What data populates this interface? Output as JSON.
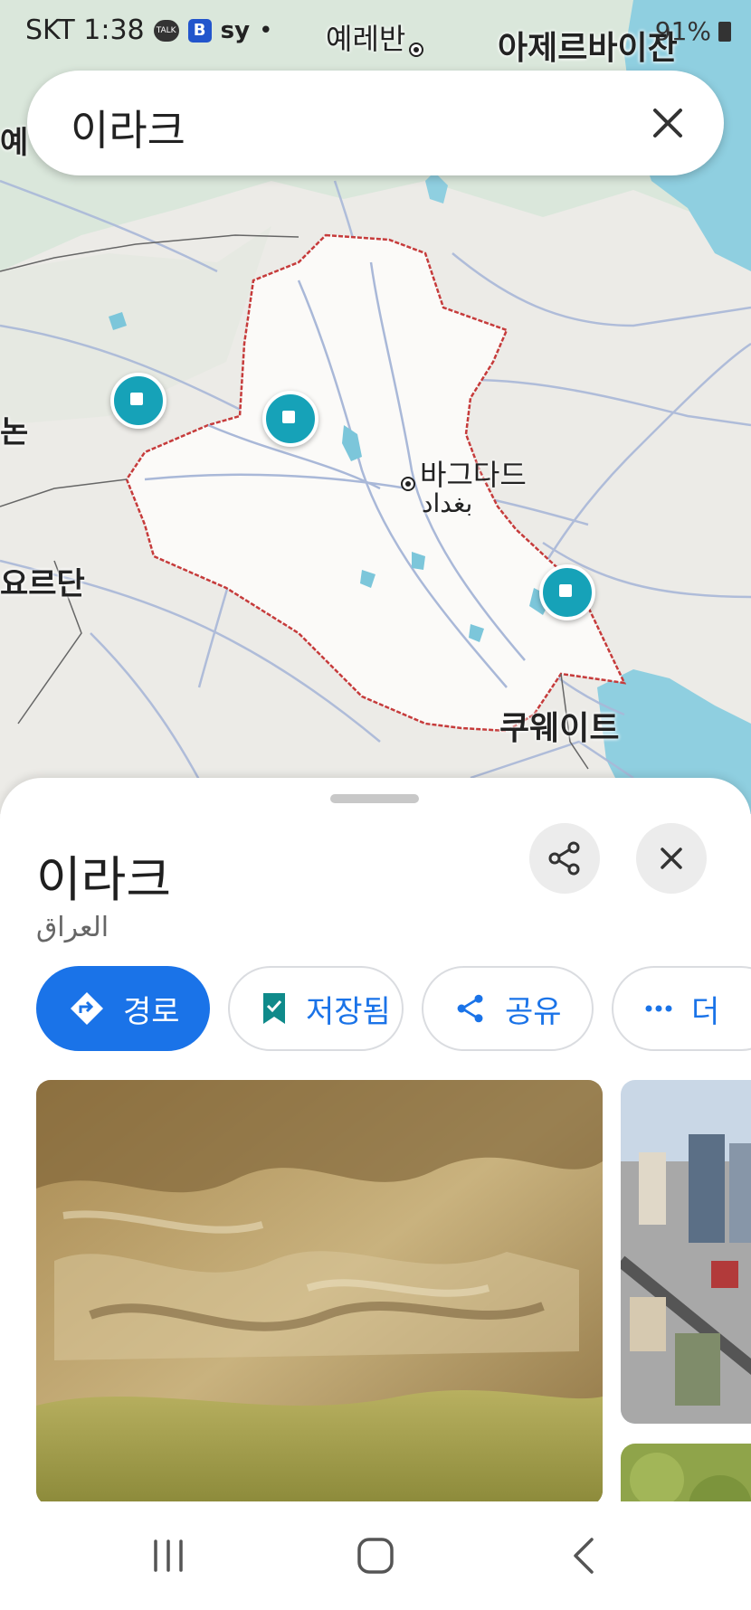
{
  "status_bar": {
    "carrier_time": "SKT 1:38",
    "talk_badge": "TALK",
    "b_app": "B",
    "sy_label": "sy",
    "dot": "•",
    "battery_percent": "91%"
  },
  "search": {
    "query": "이라크",
    "clear_icon": "close-icon"
  },
  "map": {
    "labels": {
      "yerevan": "예레반",
      "azerbaijan": "아제르바이잔",
      "ye_partial": "예",
      "non_partial": "논",
      "jordan": "요르단",
      "baghdad_ko": "바그다드",
      "baghdad_ar": "بغداد",
      "kuwait": "쿠웨이트"
    },
    "colors": {
      "land": "#ecebe7",
      "iraq_fill": "#fbfaf8",
      "border": "#c63b3b",
      "water": "#8fcfe0",
      "roads": "#a9b8d8",
      "pin": "#16a2b8"
    }
  },
  "sheet": {
    "title": "이라크",
    "subtitle": "العراق",
    "share_icon": "share-icon",
    "close_icon": "close-icon",
    "actions": [
      {
        "label": "경로",
        "icon": "directions-icon"
      },
      {
        "label": "저장됨",
        "icon": "bookmark-icon"
      },
      {
        "label": "공유",
        "icon": "share-icon"
      },
      {
        "label": "더",
        "icon": "more-icon"
      }
    ]
  },
  "nav": {
    "recents_icon": "recents-icon",
    "home_icon": "home-icon",
    "back_icon": "back-icon"
  }
}
